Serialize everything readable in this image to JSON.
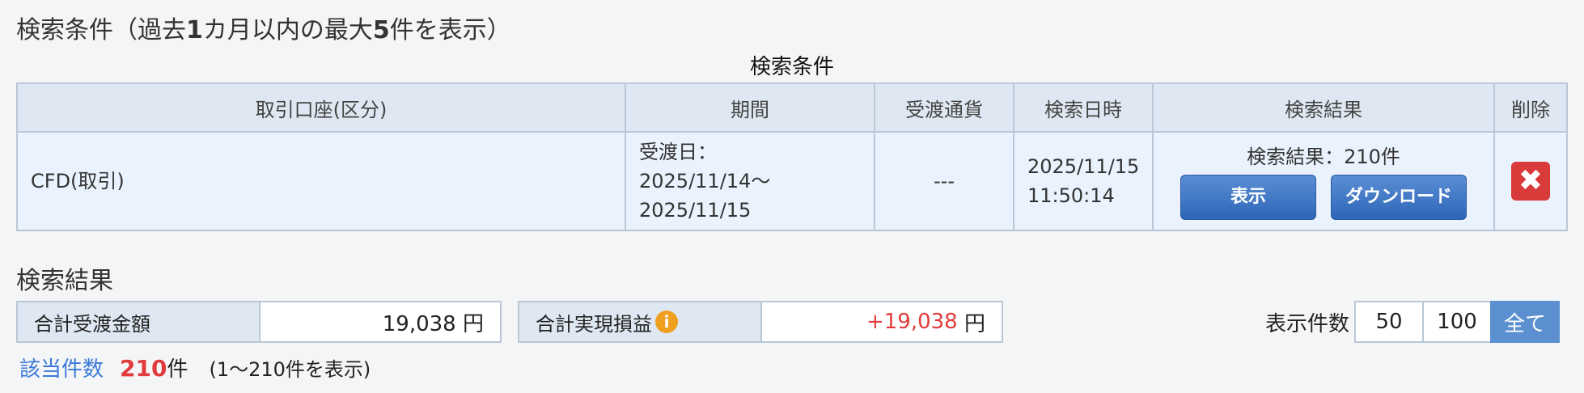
{
  "search_conditions": {
    "title_prefix": "検索条件（過去",
    "title_num1": "1",
    "title_mid": "カ月以内の最大",
    "title_num2": "5",
    "title_suffix": "件を表示）",
    "caption": "検索条件",
    "headers": [
      "取引口座(区分)",
      "期間",
      "受渡通貨",
      "検索日時",
      "検索結果",
      "削除"
    ],
    "row": {
      "account": "CFD(取引)",
      "period_line1": "受渡日：",
      "period_line2": "2025/11/14〜2025/11/15",
      "currency": "---",
      "date_line1": "2025/11/15",
      "date_line2": "11:50:14",
      "result_text": "検索結果：210件",
      "show_label": "表示",
      "download_label": "ダウンロード",
      "delete_glyph": "✖"
    }
  },
  "results": {
    "title": "検索結果",
    "total_transfer_label": "合計受渡金額",
    "total_transfer_value": "19,038 円",
    "total_pl_label": "合計実現損益",
    "total_pl_value": "+19,038",
    "total_pl_unit": " 円",
    "info_glyph": "i",
    "display_count_label": "表示件数",
    "page_sizes": [
      "50",
      "100",
      "全て"
    ],
    "active_page_size": "全て",
    "hits_label": "該当件数",
    "hits_count": "210",
    "hits_unit": "件",
    "hits_range": "(1〜210件を表示)"
  },
  "colors": {
    "accent_blue": "#3a7ad8",
    "positive_red": "#e23b3b",
    "header_bg": "#dfe8f2"
  }
}
